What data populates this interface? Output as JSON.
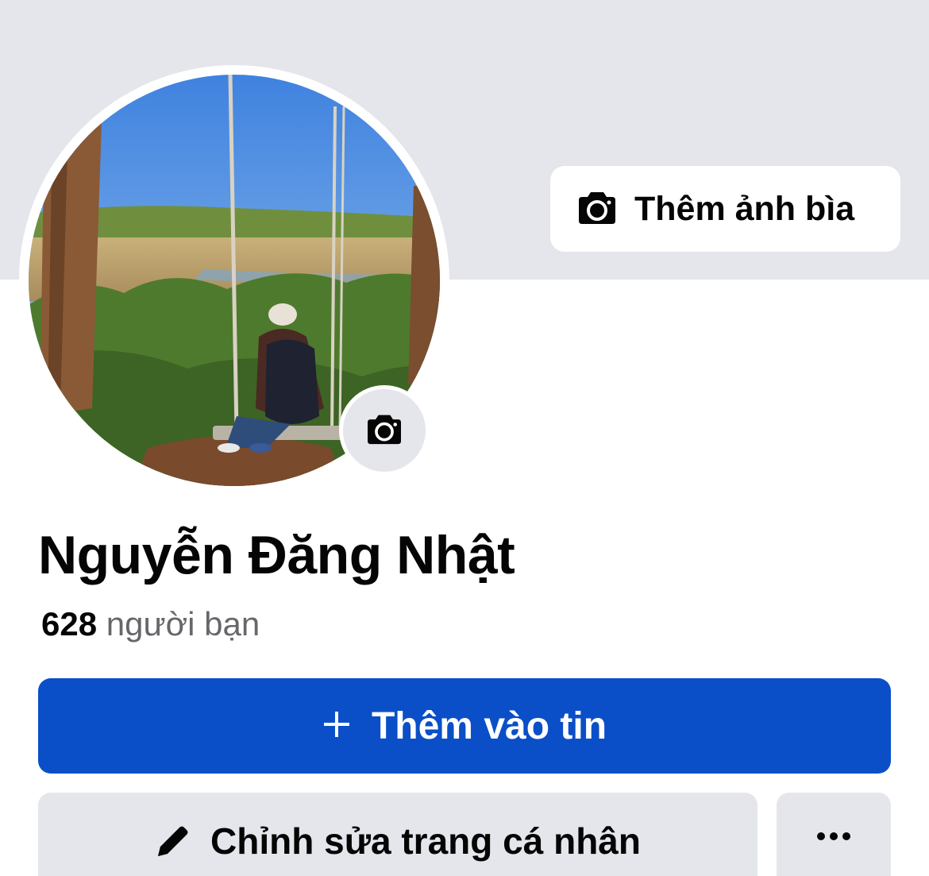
{
  "cover": {
    "add_cover_label": "Thêm ảnh bìa",
    "add_cover_icon": "camera-icon"
  },
  "profile": {
    "name": "Nguyễn Đăng Nhật",
    "friends_count": "628",
    "friends_label": "người bạn",
    "avatar_camera_icon": "camera-icon"
  },
  "actions": {
    "add_story_label": "Thêm vào tin",
    "add_story_icon": "plus-icon",
    "edit_profile_label": "Chỉnh sửa trang cá nhân",
    "edit_profile_icon": "pencil-icon",
    "more_icon": "more-icon"
  },
  "colors": {
    "cover_bg": "#e4e6eb",
    "primary_button": "#0a4fc7",
    "secondary_button": "#e4e6eb",
    "text_primary": "#050505",
    "text_secondary": "#65676b"
  }
}
